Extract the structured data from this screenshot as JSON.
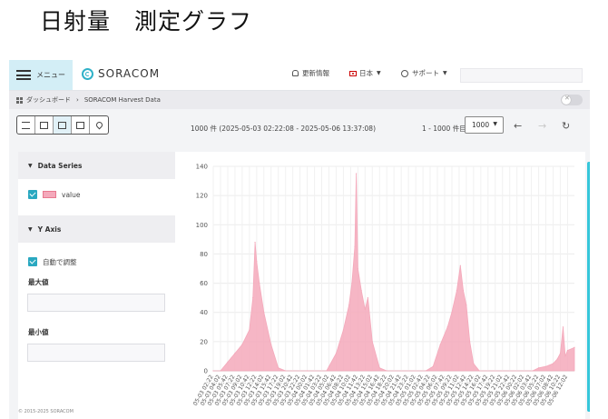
{
  "slide_title": "日射量　測定グラフ",
  "topbar": {
    "menu_label": "メニュー",
    "logo_text": "SORACOM",
    "updates_label": "更新情報",
    "language_label": "日本",
    "support_label": "サポート",
    "search_value": ""
  },
  "breadcrumb": {
    "dashboard": "ダッシュボード",
    "current": "SORACOM Harvest Data"
  },
  "toolbar": {
    "buttons": [
      "table-view",
      "line-chart",
      "bar-chart",
      "text-view",
      "map-view"
    ],
    "active": "bar-chart"
  },
  "range_text": "1000 件 (2025-05-03 02:22:08 - 2025-05-06 13:37:08)",
  "page_info": "1 - 1000 件目",
  "page_size": "1000",
  "left_panel": {
    "data_series_title": "Data Series",
    "series_label": "value",
    "y_axis_title": "Y Axis",
    "auto_adjust_label": "自動で調整",
    "max_label": "最大値",
    "min_label": "最小値",
    "max_value": "",
    "min_value": ""
  },
  "footer_text": "© 2015-2025 SORACOM",
  "chart_data": {
    "type": "area",
    "series": [
      {
        "name": "value",
        "color": "#f4a9bb"
      }
    ],
    "ylim": [
      0,
      140
    ],
    "yticks": [
      0,
      20,
      40,
      60,
      80,
      100,
      120,
      140
    ],
    "x_tick_labels": [
      "05-03 02:22",
      "05-03 04:02",
      "05-03 05:42",
      "05-03 07:22",
      "05-03 09:02",
      "05-03 10:42",
      "05-03 12:22",
      "05-03 14:02",
      "05-03 15:42",
      "05-03 17:22",
      "05-03 19:02",
      "05-03 20:42",
      "05-03 22:22",
      "05-04 00:02",
      "05-04 01:42",
      "05-04 03:22",
      "05-04 05:02",
      "05-04 06:42",
      "05-04 08:22",
      "05-04 10:02",
      "05-04 11:42",
      "05-04 13:22",
      "05-04 15:02",
      "05-04 16:42",
      "05-04 18:22",
      "05-04 20:02",
      "05-04 21:42",
      "05-04 23:22",
      "05-05 01:02",
      "05-05 02:42",
      "05-05 04:22",
      "05-05 06:02",
      "05-05 07:42",
      "05-05 09:22",
      "05-05 11:02",
      "05-05 12:42",
      "05-05 14:22",
      "05-05 16:02",
      "05-05 17:42",
      "05-05 19:22",
      "05-05 21:02",
      "05-05 22:42",
      "05-06 00:22",
      "05-06 02:02",
      "05-06 03:42",
      "05-06 05:22",
      "05-06 07:02",
      "05-06 08:42",
      "05-06 10:22",
      "05-06 12:02"
    ],
    "points": [
      [
        "05-03 02:22",
        0
      ],
      [
        "05-03 04:02",
        0
      ],
      [
        "05-03 05:42",
        6
      ],
      [
        "05-03 07:22",
        12
      ],
      [
        "05-03 09:02",
        18
      ],
      [
        "05-03 10:42",
        28
      ],
      [
        "05-03 11:30",
        50
      ],
      [
        "05-03 12:00",
        88
      ],
      [
        "05-03 12:22",
        75
      ],
      [
        "05-03 13:00",
        60
      ],
      [
        "05-03 14:02",
        40
      ],
      [
        "05-03 15:42",
        18
      ],
      [
        "05-03 17:22",
        2
      ],
      [
        "05-03 19:02",
        0
      ],
      [
        "05-04 00:02",
        0
      ],
      [
        "05-04 04:30",
        0
      ],
      [
        "05-04 05:02",
        3
      ],
      [
        "05-04 06:42",
        12
      ],
      [
        "05-04 08:22",
        28
      ],
      [
        "05-04 09:40",
        45
      ],
      [
        "05-04 10:20",
        60
      ],
      [
        "05-04 11:00",
        85
      ],
      [
        "05-04 11:20",
        135
      ],
      [
        "05-04 11:42",
        70
      ],
      [
        "05-04 12:30",
        55
      ],
      [
        "05-04 13:22",
        42
      ],
      [
        "05-04 14:00",
        50
      ],
      [
        "05-04 15:02",
        20
      ],
      [
        "05-04 16:42",
        2
      ],
      [
        "05-04 18:22",
        0
      ],
      [
        "05-05 03:22",
        0
      ],
      [
        "05-05 05:02",
        3
      ],
      [
        "05-05 06:42",
        18
      ],
      [
        "05-05 08:22",
        30
      ],
      [
        "05-05 09:22",
        40
      ],
      [
        "05-05 10:30",
        55
      ],
      [
        "05-05 11:20",
        72
      ],
      [
        "05-05 12:00",
        55
      ],
      [
        "05-05 12:42",
        45
      ],
      [
        "05-05 13:30",
        20
      ],
      [
        "05-05 14:22",
        5
      ],
      [
        "05-05 15:42",
        0
      ],
      [
        "05-06 04:00",
        0
      ],
      [
        "05-06 05:22",
        2
      ],
      [
        "05-06 07:02",
        3
      ],
      [
        "05-06 08:42",
        5
      ],
      [
        "05-06 09:40",
        8
      ],
      [
        "05-06 10:22",
        12
      ],
      [
        "05-06 11:00",
        30
      ],
      [
        "05-06 11:30",
        10
      ],
      [
        "05-06 12:02",
        14
      ],
      [
        "05-06 13:37",
        16
      ]
    ]
  }
}
